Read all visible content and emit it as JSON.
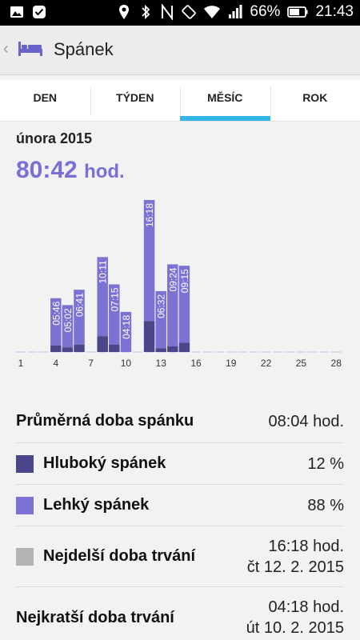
{
  "status_bar": {
    "battery": "66%",
    "time": "21:43",
    "icons": [
      "image-icon",
      "check-icon",
      "location-icon",
      "bluetooth-icon",
      "nfc-icon",
      "rotate-icon",
      "wifi-icon",
      "signal-icon",
      "battery-icon"
    ]
  },
  "header": {
    "title": "Spánek",
    "icon": "bed-icon",
    "back_icon": "chevron-left-icon"
  },
  "tabs": [
    {
      "label": "DEN",
      "active": false
    },
    {
      "label": "TÝDEN",
      "active": false
    },
    {
      "label": "MĚSÍC",
      "active": true
    },
    {
      "label": "ROK",
      "active": false
    }
  ],
  "summary": {
    "month": "února 2015",
    "total": "80:42",
    "total_unit": "hod."
  },
  "chart_data": {
    "type": "bar",
    "stacked": true,
    "x_ticks": [
      "1",
      "4",
      "7",
      "10",
      "13",
      "16",
      "19",
      "22",
      "25",
      "28"
    ],
    "categories": [
      1,
      2,
      3,
      4,
      5,
      6,
      7,
      8,
      9,
      10,
      11,
      12,
      13,
      14,
      15,
      16,
      17,
      18,
      19,
      20,
      21,
      22,
      23,
      24,
      25,
      26,
      27,
      28
    ],
    "bar_labels": [
      "",
      "",
      "",
      "05:46",
      "05:02",
      "06:41",
      "",
      "10:11",
      "07:15",
      "04:18",
      "",
      "16:18",
      "06:32",
      "09:24",
      "09:15",
      "",
      "",
      "",
      "",
      "",
      "",
      "",
      "",
      "",
      "",
      "",
      "",
      ""
    ],
    "series": [
      {
        "name": "Hluboký spánek",
        "color": "#4b468a",
        "values": [
          0,
          0,
          0,
          0.7,
          0.5,
          0.8,
          0,
          1.7,
          0.8,
          0,
          0,
          3.3,
          0.4,
          0.6,
          1.0,
          0,
          0,
          0,
          0,
          0,
          0,
          0,
          0,
          0,
          0,
          0,
          0,
          0
        ]
      },
      {
        "name": "Lehký spánek",
        "color": "#7b72d4",
        "values": [
          0,
          0,
          0,
          5.07,
          4.53,
          5.88,
          0,
          8.48,
          6.45,
          4.3,
          0,
          13.0,
          6.13,
          8.8,
          8.25,
          0,
          0,
          0,
          0,
          0,
          0,
          0,
          0,
          0,
          0,
          0,
          0,
          0
        ]
      }
    ],
    "ylim": [
      0,
      16.3
    ]
  },
  "colors": {
    "accent": "#7a6fd6",
    "deep": "#4b468a",
    "light": "#7b72d4",
    "duration": "#b3b3b3",
    "tab_indicator": "#33b5e5"
  },
  "stats": {
    "average": {
      "label": "Průměrná doba spánku",
      "value": "08:04 hod."
    },
    "deep": {
      "label": "Hluboký spánek",
      "value": "12 %"
    },
    "light": {
      "label": "Lehký spánek",
      "value": "88 %"
    },
    "longest": {
      "label": "Nejdelší doba trvání",
      "value": "16:18 hod.",
      "date": "čt 12. 2. 2015"
    },
    "shortest": {
      "label": "Nejkratší doba trvání",
      "value": "04:18 hod.",
      "date": "út 10. 2. 2015"
    }
  }
}
